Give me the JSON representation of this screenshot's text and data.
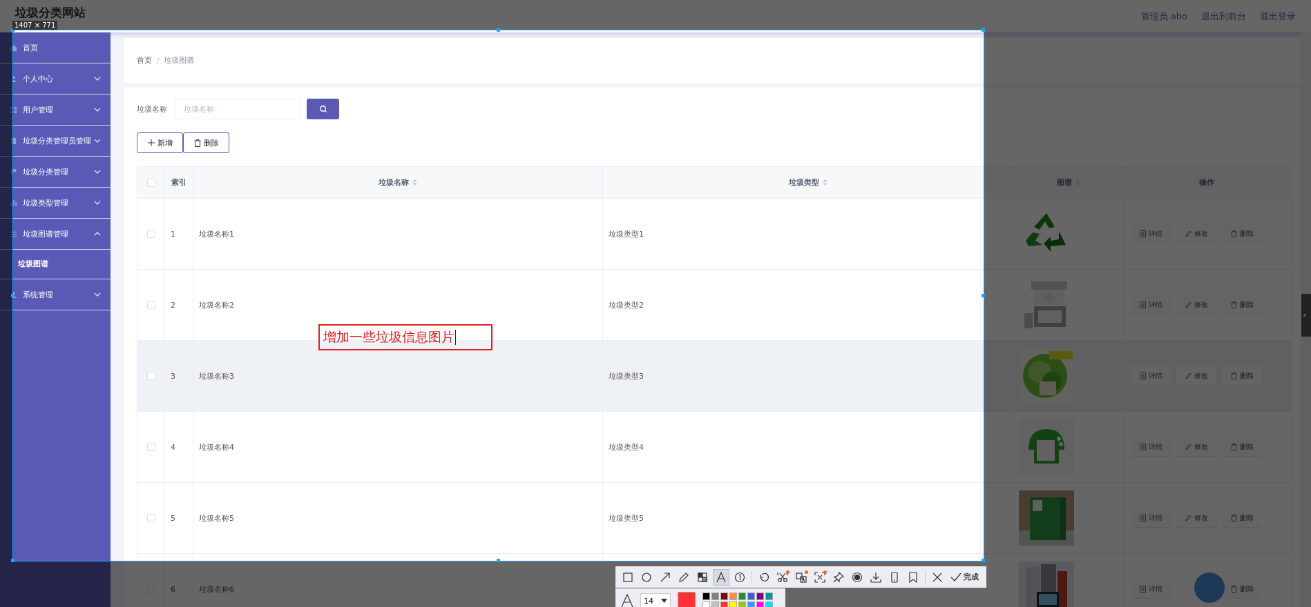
{
  "header": {
    "title": "垃圾分类网站",
    "links": [
      "管理员 abo",
      "退出到前台",
      "退出登录"
    ]
  },
  "sidebar": {
    "items": [
      {
        "kind": "link",
        "label": "首页"
      },
      {
        "kind": "submenu",
        "label": "个人中心",
        "expanded": false
      },
      {
        "kind": "submenu",
        "label": "用户管理",
        "expanded": false
      },
      {
        "kind": "submenu",
        "label": "垃圾分类管理员管理",
        "expanded": false
      },
      {
        "kind": "submenu",
        "label": "垃圾分类管理",
        "expanded": false
      },
      {
        "kind": "submenu",
        "label": "垃圾类型管理",
        "expanded": false
      },
      {
        "kind": "submenu",
        "label": "垃圾图谱管理",
        "expanded": true,
        "children": [
          {
            "label": "垃圾图谱"
          }
        ]
      },
      {
        "kind": "submenu",
        "label": "系统管理",
        "expanded": false
      }
    ]
  },
  "breadcrumb": [
    "首页",
    "垃圾图谱"
  ],
  "search": {
    "label": "垃圾名称",
    "placeholder": "垃圾名称"
  },
  "actions": [
    {
      "kind": "add",
      "label": "新增"
    },
    {
      "kind": "delete",
      "label": "删除"
    }
  ],
  "table": {
    "columns": [
      {
        "kind": "checkbox",
        "checked": false
      },
      {
        "kind": "text",
        "label": "索引",
        "sortable": false
      },
      {
        "kind": "text",
        "label": "垃圾名称",
        "sortable": true
      },
      {
        "kind": "text",
        "label": "垃圾类型",
        "sortable": true
      },
      {
        "kind": "text",
        "label": "图谱",
        "sortable": true
      },
      {
        "kind": "text",
        "label": "操作",
        "sortable": false
      }
    ],
    "rows": [
      {
        "checked": false,
        "hovered": false,
        "index": "1",
        "name": "垃圾名称1",
        "type": "垃圾类型1",
        "picture": {
          "kind": "picture"
        },
        "operations": [
          {
            "kind": "detail",
            "label": "详情"
          },
          {
            "kind": "edit",
            "label": "修改"
          },
          {
            "kind": "delete",
            "label": "删除"
          }
        ]
      },
      {
        "checked": false,
        "hovered": false,
        "index": "2",
        "name": "垃圾名称2",
        "type": "垃圾类型2",
        "picture": {
          "kind": "picture"
        },
        "operations": [
          {
            "kind": "detail",
            "label": "详情"
          },
          {
            "kind": "edit",
            "label": "修改"
          },
          {
            "kind": "delete",
            "label": "删除"
          }
        ]
      },
      {
        "checked": false,
        "hovered": true,
        "index": "3",
        "name": "垃圾名称3",
        "type": "垃圾类型3",
        "picture": {
          "kind": "picture"
        },
        "operations": [
          {
            "kind": "detail",
            "label": "详情"
          },
          {
            "kind": "edit",
            "label": "修改"
          },
          {
            "kind": "delete",
            "label": "删除"
          }
        ]
      },
      {
        "checked": false,
        "hovered": false,
        "index": "4",
        "name": "垃圾名称4",
        "type": "垃圾类型4",
        "picture": {
          "kind": "picture"
        },
        "operations": [
          {
            "kind": "detail",
            "label": "详情"
          },
          {
            "kind": "edit",
            "label": "修改"
          },
          {
            "kind": "delete",
            "label": "删除"
          }
        ]
      },
      {
        "checked": false,
        "hovered": false,
        "index": "5",
        "name": "垃圾名称5",
        "type": "垃圾类型5",
        "picture": {
          "kind": "picture"
        },
        "operations": [
          {
            "kind": "detail",
            "label": "详情"
          },
          {
            "kind": "edit",
            "label": "修改"
          },
          {
            "kind": "delete",
            "label": "删除"
          }
        ]
      },
      {
        "checked": false,
        "hovered": false,
        "index": "6",
        "name": "垃圾名称6",
        "picture": {
          "kind": "picture"
        },
        "operations": [
          {
            "kind": "detail",
            "label": "详情"
          },
          {
            "kind": "delete",
            "label": "删除"
          }
        ]
      }
    ]
  },
  "screenshot_tool": {
    "size_label": "1407 × 771",
    "annotation": "增加一些垃圾信息图片",
    "tools": [
      {
        "kind": "rectangle",
        "selected": false,
        "badge": false
      },
      {
        "kind": "ellipse",
        "selected": false,
        "badge": false
      },
      {
        "kind": "arrow",
        "selected": false,
        "badge": false
      },
      {
        "kind": "pencil",
        "selected": false,
        "badge": false
      },
      {
        "kind": "mosaic",
        "selected": false,
        "badge": false
      },
      {
        "kind": "text",
        "selected": true,
        "badge": false
      },
      {
        "kind": "number",
        "selected": false,
        "badge": false
      },
      {
        "kind": "separator"
      },
      {
        "kind": "undo",
        "selected": false,
        "badge": false
      },
      {
        "kind": "cut",
        "selected": false,
        "badge": true
      },
      {
        "kind": "translate",
        "selected": false,
        "badge": true
      },
      {
        "kind": "ocr",
        "selected": false,
        "badge": true
      },
      {
        "kind": "pin",
        "selected": false,
        "badge": false
      },
      {
        "kind": "record",
        "selected": false,
        "badge": false
      },
      {
        "kind": "download",
        "selected": false,
        "badge": false
      },
      {
        "kind": "phone",
        "selected": false,
        "badge": false
      },
      {
        "kind": "bookmark",
        "selected": false,
        "badge": false
      },
      {
        "kind": "separator"
      },
      {
        "kind": "close",
        "selected": false,
        "badge": false
      }
    ],
    "done_label": "完成",
    "font_size": "14",
    "current_color": {
      "color": "#ff3333"
    },
    "palette": [
      {
        "color": "#000000"
      },
      {
        "color": "#808080"
      },
      {
        "color": "#800000"
      },
      {
        "color": "#ff8c3c"
      },
      {
        "color": "#2e8b2e"
      },
      {
        "color": "#3c5adc"
      },
      {
        "color": "#800080"
      },
      {
        "color": "#009999"
      },
      {
        "color": "#ffffff"
      },
      {
        "color": "#c0c0c0"
      },
      {
        "color": "#ff3333"
      },
      {
        "color": "#ffff00"
      },
      {
        "color": "#99cc00"
      },
      {
        "color": "#3399ff"
      },
      {
        "color": "#ff00ff"
      },
      {
        "color": "#00e5e5"
      }
    ]
  }
}
